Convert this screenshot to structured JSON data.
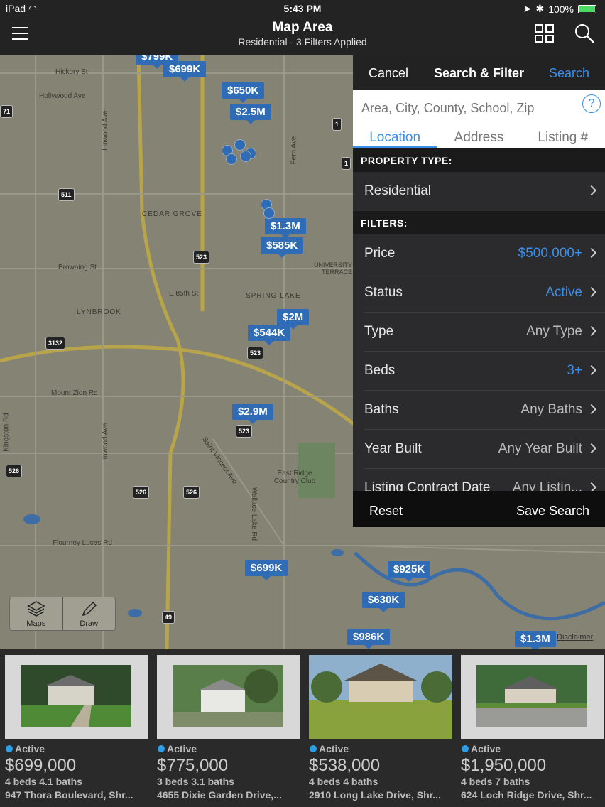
{
  "status_bar": {
    "device": "iPad",
    "time": "5:43 PM",
    "battery": "100%"
  },
  "header": {
    "title": "Map Area",
    "subtitle": "Residential - 3 Filters Applied"
  },
  "map": {
    "pins": [
      "$799K",
      "$699K",
      "$650K",
      "$2.5M",
      "$1.3M",
      "$585K",
      "$2M",
      "$544K",
      "$2.9M",
      "$699K",
      "$925K",
      "$630K",
      "$986K",
      "$1.3M"
    ],
    "labels": [
      "Hickory St",
      "Hollywood Ave",
      "Linwood Ave",
      "CEDAR GROVE",
      "Browning St",
      "E 85th St",
      "LYNBROOK",
      "SPRING LAKE",
      "UNIVERSITY TERRACE",
      "Mount Zion Rd",
      "Kingston Rd",
      "Linwood Ave",
      "Saint Vincent Ave",
      "Wallace Lake Rd",
      "East Ridge Country Club",
      "Flournoy Lucas Rd",
      "Fern Ave"
    ],
    "shields": [
      "71",
      "511",
      "523",
      "3132",
      "523",
      "523",
      "526",
      "526",
      "526",
      "1",
      "1",
      "49"
    ],
    "tools": {
      "maps": "Maps",
      "draw": "Draw"
    },
    "disclaimer": "Disclaimer"
  },
  "panel": {
    "cancel": "Cancel",
    "title": "Search & Filter",
    "search": "Search",
    "search_placeholder": "Area, City, County, School, Zip",
    "help": "?",
    "tabs": [
      "Location",
      "Address",
      "Listing #"
    ],
    "property_type_header": "PROPERTY TYPE:",
    "property_type": "Residential",
    "filters_header": "FILTERS:",
    "filters": [
      {
        "label": "Price",
        "value": "$500,000+"
      },
      {
        "label": "Status",
        "value": "Active"
      },
      {
        "label": "Type",
        "value": "Any Type"
      },
      {
        "label": "Beds",
        "value": "3+"
      },
      {
        "label": "Baths",
        "value": "Any Baths"
      },
      {
        "label": "Year Built",
        "value": "Any Year Built"
      },
      {
        "label": "Listing Contract Date",
        "value": "Any Listin..."
      }
    ],
    "reset": "Reset",
    "save_search": "Save Search"
  },
  "listings": [
    {
      "status": "Active",
      "price": "$699,000",
      "beds": "4 beds 4.1 baths",
      "address": "947 Thora Boulevard, Shr..."
    },
    {
      "status": "Active",
      "price": "$775,000",
      "beds": "3 beds 3.1 baths",
      "address": "4655 Dixie Garden Drive,..."
    },
    {
      "status": "Active",
      "price": "$538,000",
      "beds": "4 beds 4 baths",
      "address": "2910 Long Lake Drive, Shr..."
    },
    {
      "status": "Active",
      "price": "$1,950,000",
      "beds": "4 beds 7 baths",
      "address": "624 Loch Ridge Drive, Shr..."
    }
  ],
  "colors": {
    "accent": "#3b8fe8",
    "pin": "#2f6cb5",
    "active_dot": "#2e9fe6"
  }
}
